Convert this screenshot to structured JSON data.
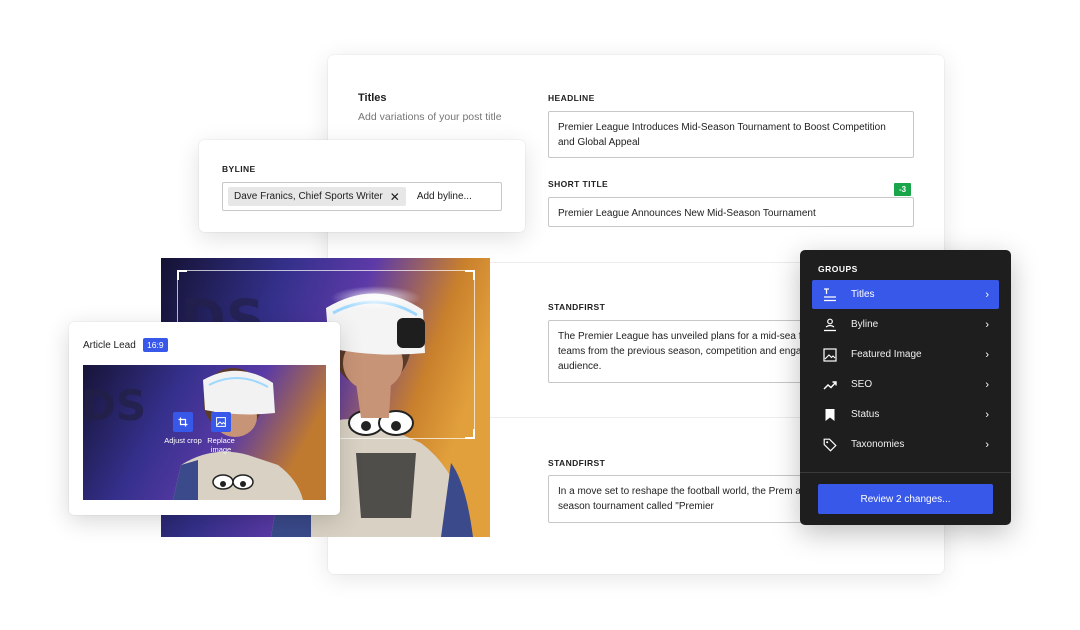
{
  "titles_section": {
    "title": "Titles",
    "description": "Add variations of your post title",
    "headline_label": "HEADLINE",
    "headline_value": "Premier League Introduces Mid-Season Tournament to Boost Competition and Global Appeal",
    "short_title_label": "SHORT TITLE",
    "short_title_value": "Premier League Announces New Mid-Season Tournament",
    "short_title_counter": "-3"
  },
  "standfirst_1": {
    "label": "STANDFIRST",
    "value": "The Premier League has unveiled plans for a mid-sea featuring the top six teams from the previous season, competition and engaging a global audience."
  },
  "standfirst_2": {
    "label": "STANDFIRST",
    "value": "In a move set to reshape the football world, the Prem announced an in-season tournament called \"Premier"
  },
  "byline_card": {
    "label": "BYLINE",
    "chip": "Dave Franics, Chief Sports Writer",
    "add_placeholder": "Add byline..."
  },
  "article_lead": {
    "title": "Article Lead",
    "ratio": "16:9",
    "adjust_crop": "Adjust crop",
    "replace_image": "Replace image"
  },
  "groups": {
    "heading": "GROUPS",
    "items": [
      {
        "label": "Titles",
        "icon": "titles-icon",
        "active": true
      },
      {
        "label": "Byline",
        "icon": "byline-icon",
        "active": false
      },
      {
        "label": "Featured Image",
        "icon": "image-icon",
        "active": false
      },
      {
        "label": "SEO",
        "icon": "trending-icon",
        "active": false
      },
      {
        "label": "Status",
        "icon": "bookmark-icon",
        "active": false
      },
      {
        "label": "Taxonomies",
        "icon": "tag-icon",
        "active": false
      }
    ],
    "review_button": "Review 2 changes..."
  },
  "colors": {
    "accent": "#3858e9",
    "panel_bg": "#1e1e1e",
    "counter_green": "#1aa54a"
  }
}
